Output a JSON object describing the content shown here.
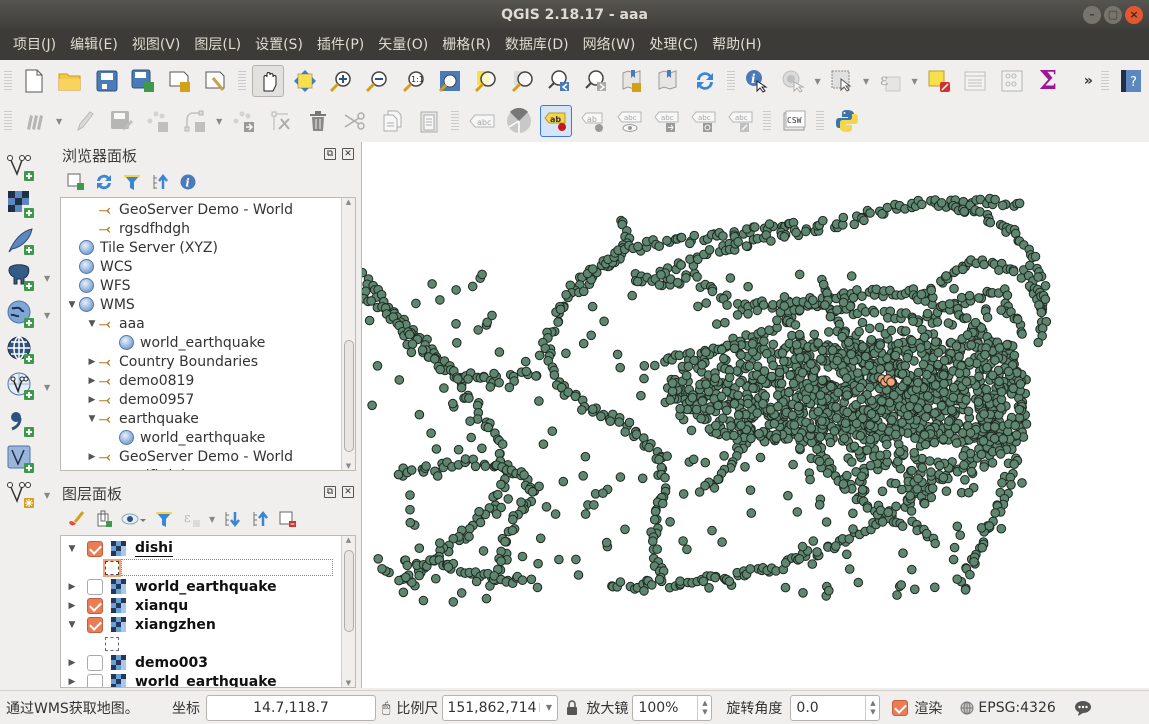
{
  "window": {
    "title": "QGIS 2.18.17 - aaa",
    "buttons": [
      "minimize",
      "maximize",
      "close"
    ]
  },
  "menubar": [
    {
      "label": "项目(J)"
    },
    {
      "label": "编辑(E)"
    },
    {
      "label": "视图(V)"
    },
    {
      "label": "图层(L)"
    },
    {
      "label": "设置(S)"
    },
    {
      "label": "插件(P)"
    },
    {
      "label": "矢量(O)"
    },
    {
      "label": "栅格(R)"
    },
    {
      "label": "数据库(D)"
    },
    {
      "label": "网络(W)"
    },
    {
      "label": "处理(C)"
    },
    {
      "label": "帮助(H)"
    }
  ],
  "toolbar1": {
    "icons": [
      "new-project-icon",
      "open-project-icon",
      "save-project-icon",
      "save-as-icon",
      "new-print-composer-icon",
      "composer-manager-icon",
      "pan-icon",
      "pan-to-selection-icon",
      "zoom-in-icon",
      "zoom-out-icon",
      "zoom-native-icon",
      "zoom-full-icon",
      "zoom-to-selection-icon",
      "zoom-to-layer-icon",
      "zoom-last-icon",
      "zoom-next-icon",
      "new-bookmark-icon",
      "show-bookmarks-icon",
      "refresh-icon",
      "identify-icon",
      "run-action-icon",
      "select-features-icon",
      "select-by-expression-icon",
      "deselect-all-icon",
      "attribute-table-icon",
      "field-calculator-icon",
      "statistics-sigma-icon",
      "more-tools",
      "help-icon"
    ],
    "overflow_label": "»"
  },
  "toolbar2": {
    "icons": [
      "current-edits-icon",
      "toggle-editing-icon",
      "save-edits-icon",
      "add-feature-icon",
      "node-tool-icon",
      "move-feature-icon",
      "delete-part-icon",
      "delete-selected-icon",
      "cut-features-icon",
      "copy-features-icon",
      "paste-features-icon",
      "label-tool-icon",
      "diagram-tool-icon",
      "pin-labels-icon",
      "show-hide-labels-icon",
      "preview-labels-icon",
      "move-label-icon",
      "rotate-label-icon",
      "change-label-icon",
      "csw-icon",
      "python-console-icon"
    ],
    "csw_label": "CSW",
    "abc_label": "abc",
    "ab_label": "ab"
  },
  "left_toolbar": {
    "icons": [
      "add-vector-layer-icon",
      "add-raster-layer-icon",
      "add-spatialite-layer-icon",
      "add-postgis-layer-icon",
      "add-wms-layer-icon",
      "add-wcs-layer-icon",
      "add-wfs-layer-icon",
      "add-delimited-text-icon",
      "add-virtual-layer-icon",
      "new-shapefile-icon"
    ]
  },
  "browser_panel": {
    "title": "浏览器面板",
    "tools": [
      "add-selected-icon",
      "refresh-icon",
      "filter-icon",
      "collapse-all-icon",
      "properties-icon"
    ],
    "items": [
      {
        "label": "GeoServer Demo - World",
        "type": "wms-connection",
        "level": 2,
        "expander": ""
      },
      {
        "label": "rgsdfhdgh",
        "type": "wms-connection",
        "level": 2,
        "expander": ""
      },
      {
        "label": "Tile Server (XYZ)",
        "type": "globe",
        "level": 1,
        "expander": ""
      },
      {
        "label": "WCS",
        "type": "globe",
        "level": 1,
        "expander": ""
      },
      {
        "label": "WFS",
        "type": "globe",
        "level": 1,
        "expander": ""
      },
      {
        "label": "WMS",
        "type": "globe",
        "level": 1,
        "expander": "▼"
      },
      {
        "label": "aaa",
        "type": "wms-connection",
        "level": 2,
        "expander": "▼"
      },
      {
        "label": "world_earthquake",
        "type": "globe",
        "level": 3,
        "expander": ""
      },
      {
        "label": "Country Boundaries",
        "type": "wms-connection",
        "level": 2,
        "expander": "▶"
      },
      {
        "label": "demo0819",
        "type": "wms-connection",
        "level": 2,
        "expander": "▶"
      },
      {
        "label": "demo0957",
        "type": "wms-connection",
        "level": 2,
        "expander": "▶"
      },
      {
        "label": "earthquake",
        "type": "wms-connection",
        "level": 2,
        "expander": "▼"
      },
      {
        "label": "world_earthquake",
        "type": "globe",
        "level": 3,
        "expander": ""
      },
      {
        "label": "GeoServer Demo - World",
        "type": "wms-connection",
        "level": 2,
        "expander": "▶"
      },
      {
        "label": "rgsdfhdgh",
        "type": "wms-connection",
        "level": 2,
        "expander": ""
      }
    ]
  },
  "layers_panel": {
    "title": "图层面板",
    "tools": [
      "style-manager-icon",
      "add-group-icon",
      "manage-visibility-icon",
      "filter-legend-icon",
      "filter-by-expression-icon",
      "expand-all-icon",
      "collapse-all-icon",
      "remove-layer-icon"
    ],
    "layers": [
      {
        "name": "dishi",
        "checked": true,
        "expanded": true,
        "legend_symbol": "selected"
      },
      {
        "name": "world_earthquake",
        "checked": false,
        "expanded": false
      },
      {
        "name": "xianqu",
        "checked": true,
        "expanded": false
      },
      {
        "name": "xiangzhen",
        "checked": true,
        "expanded": true,
        "legend_symbol": "empty"
      },
      {
        "name": "demo003",
        "checked": false,
        "expanded": false
      },
      {
        "name": "world_earthquake",
        "checked": false,
        "expanded": false
      }
    ]
  },
  "map": {
    "point_fill": "#5e8670",
    "point_stroke": "#1f2a22",
    "highlight_fill": "#f4a27a",
    "background": "#ffffff"
  },
  "statusbar": {
    "message": "通过WMS获取地图。",
    "coord_label": "坐标",
    "coord_value": "14.7,118.7",
    "scale_label": "比例尺",
    "scale_value": "151,862,714",
    "magnifier_label": "放大镜",
    "magnifier_value": "100%",
    "rotation_label": "旋转角度",
    "rotation_value": "0.0",
    "render_label": "渲染",
    "render_checked": true,
    "crs_label": "EPSG:4326"
  }
}
